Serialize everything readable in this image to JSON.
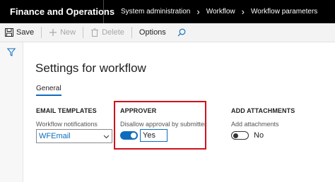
{
  "app": {
    "title": "Finance and Operations"
  },
  "breadcrumb": [
    "System administration",
    "Workflow",
    "Workflow parameters"
  ],
  "toolbar": {
    "save": "Save",
    "new": "New",
    "delete": "Delete",
    "options": "Options"
  },
  "page": {
    "title": "Settings for workflow",
    "tab": "General"
  },
  "sections": {
    "email_templates": {
      "heading": "EMAIL TEMPLATES",
      "field_label": "Workflow notifications",
      "field_value": "WFEmail"
    },
    "approver": {
      "heading": "APPROVER",
      "field_label": "Disallow approval by submitter",
      "toggle_value": "Yes",
      "toggle_on": true
    },
    "add_attachments": {
      "heading": "ADD ATTACHMENTS",
      "field_label": "Add attachments",
      "toggle_value": "No",
      "toggle_on": false
    }
  },
  "colors": {
    "accent": "#0f6cbd",
    "highlight": "#d0121b",
    "topbar": "#000000"
  },
  "icons": [
    "save-icon",
    "plus-icon",
    "trash-icon",
    "search-icon",
    "filter-icon",
    "chevron-down-icon",
    "chevron-right-icon"
  ]
}
